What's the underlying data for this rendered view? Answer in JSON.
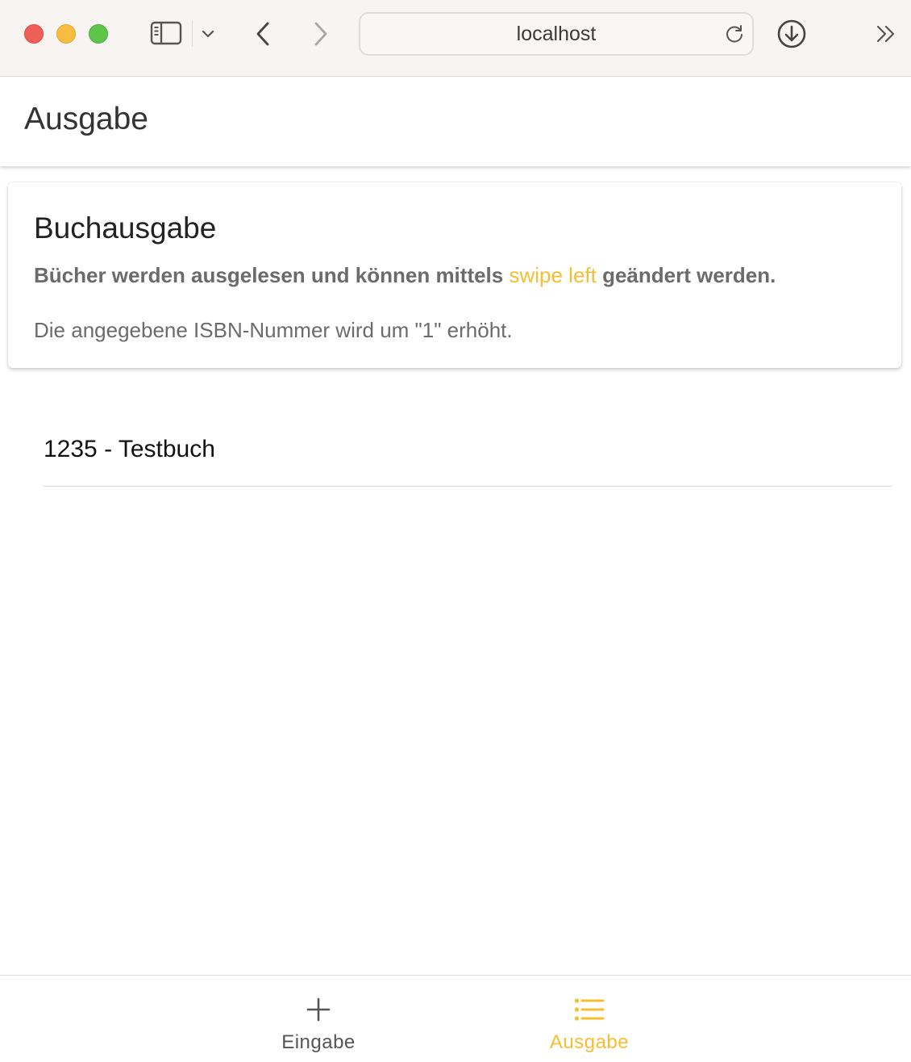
{
  "browser": {
    "url": "localhost",
    "icons": {
      "sidebar": "sidebar-icon",
      "chevron": "chevron-down-icon",
      "back": "back-arrow-icon",
      "forward": "forward-arrow-icon",
      "reload": "reload-icon",
      "download": "download-icon",
      "more": "double-chevron-right-icon"
    },
    "colors": {
      "close": "#ee5f57",
      "minimize": "#f6bd41",
      "maximize": "#5ec54b"
    }
  },
  "header": {
    "title": "Ausgabe"
  },
  "card": {
    "title": "Buchausgabe",
    "subtitle_before": "Bücher werden ausgelesen und können mittels ",
    "subtitle_accent": "swipe left",
    "subtitle_after": " geändert werden.",
    "text": "Die angegebene ISBN-Nummer wird um \"1\" erhöht."
  },
  "books": [
    {
      "label": "1235 - Testbuch"
    }
  ],
  "tabs": [
    {
      "label": "Eingabe",
      "icon": "plus-icon",
      "active": false
    },
    {
      "label": "Ausgabe",
      "icon": "list-icon",
      "active": true
    }
  ],
  "theme": {
    "accent": "#f6bf32",
    "text_muted": "#6b6b6b"
  }
}
